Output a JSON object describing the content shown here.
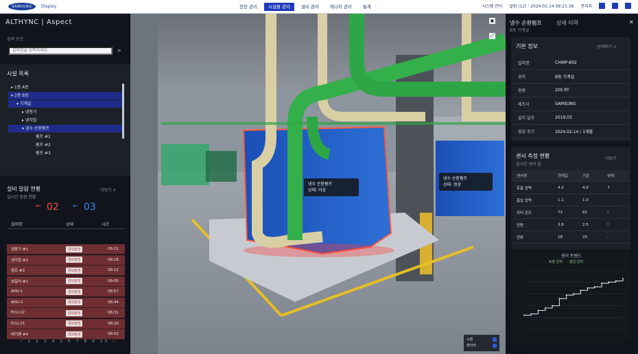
{
  "header": {
    "logo_text": "SAMSUNG",
    "logo_sub": "Display",
    "nav": [
      {
        "label": "현장 관리"
      },
      {
        "label": "시설물 관리"
      },
      {
        "label": "설비 관리"
      },
      {
        "label": "에너지 관리"
      },
      {
        "label": "통계"
      }
    ],
    "right_links": [
      {
        "label": "시스템 관리"
      },
      {
        "label": "알림 (12) · 2024.02.14 09:21:36"
      },
      {
        "label": "관리자"
      }
    ]
  },
  "left_panel": {
    "brand": "ALTHYNC | Aspect",
    "search": {
      "title": "검색 조건",
      "placeholder": "설비명을 입력하세요"
    },
    "tree": {
      "title": "시설 목록",
      "items": [
        {
          "label": "▸ 1층 A동",
          "level": 0,
          "selected": false
        },
        {
          "label": "▾ 2층 B동",
          "level": 0,
          "selected": true
        },
        {
          "label": "▾ 기계실",
          "level": 1,
          "selected": true
        },
        {
          "label": "▸ 냉동기",
          "level": 2,
          "selected": false
        },
        {
          "label": "▸ 냉각탑",
          "level": 2,
          "selected": false
        },
        {
          "label": "▾ 냉수 순환펌프",
          "level": 2,
          "selected": true
        },
        {
          "label": "펌프 #1",
          "level": 3,
          "selected": false
        },
        {
          "label": "펌프 #2",
          "level": 3,
          "selected": false
        },
        {
          "label": "펌프 #3",
          "level": 3,
          "selected": false
        }
      ]
    },
    "alarm": {
      "title": "설비 알람 현황",
      "subtitle": "실시간 알람 현황",
      "more": "더보기 >",
      "red_count": "02",
      "blue_count": "03",
      "columns": [
        "설비명",
        "상태",
        "시간"
      ],
      "rows": [
        {
          "name": "냉동기 #1",
          "status": "경보발생",
          "time": "09:21"
        },
        {
          "name": "냉각탑 #2",
          "status": "경보발생",
          "time": "09:18"
        },
        {
          "name": "펌프 #3",
          "status": "경보발생",
          "time": "09:12"
        },
        {
          "name": "보일러 #1",
          "status": "경보발생",
          "time": "09:05"
        },
        {
          "name": "AHU-1",
          "status": "경보발생",
          "time": "08:57"
        },
        {
          "name": "AHU-2",
          "status": "경보발생",
          "time": "08:44"
        },
        {
          "name": "FCU-12",
          "status": "경보발생",
          "time": "08:31"
        },
        {
          "name": "FCU-15",
          "status": "경보발생",
          "time": "08:20"
        },
        {
          "name": "배기팬 #4",
          "status": "경보발생",
          "time": "08:02"
        }
      ],
      "pager": "‹ 1 2 3 4 5 6 7 8 9 10 ›"
    }
  },
  "scene": {
    "tag_main": {
      "line1": "냉수 순환펌프",
      "line2": "상태: 이상"
    },
    "tag_right": {
      "line1": "냉수 순환펌프",
      "line2": "상태: 정상"
    },
    "bottom_controls": [
      {
        "label": "시점"
      },
      {
        "label": "레이어"
      }
    ],
    "toolbar": [
      {
        "icon": "layers-icon"
      },
      {
        "icon": "expand-icon"
      }
    ]
  },
  "right_panel": {
    "title": "냉수 순환펌프",
    "subtitle": "B동 기계실",
    "tab2": "상세 이력",
    "info": {
      "title": "기본 정보",
      "more": "상세보기 >",
      "rows": [
        {
          "key": "설비명",
          "value": "CHWP-B02"
        },
        {
          "key": "위치",
          "value": "B동 기계실"
        },
        {
          "key": "용량",
          "value": "200 RT"
        },
        {
          "key": "제조사",
          "value": "SAMSUNG"
        },
        {
          "key": "설치 일자",
          "value": "2019.03"
        },
        {
          "key": "점검 주기",
          "value": "2024.02.14 / 1개월"
        }
      ]
    },
    "sensors": {
      "title": "센서 측정 현황",
      "subtitle": "실시간 센서 값",
      "more": "더보기",
      "columns": [
        "센서명",
        "현재값",
        "기준",
        "상태"
      ],
      "rows": [
        {
          "name": "토출 압력",
          "value": "4.2",
          "std": "4.0",
          "state": "↑"
        },
        {
          "name": "흡입 압력",
          "value": "1.1",
          "std": "1.0",
          "state": "-"
        },
        {
          "name": "모터 온도",
          "value": "72",
          "std": "65",
          "state": "!"
        },
        {
          "name": "진동",
          "value": "3.8",
          "std": "2.5",
          "state": "!"
        },
        {
          "name": "전류",
          "value": "18",
          "std": "20",
          "state": "-"
        }
      ]
    },
    "chart": {
      "title": "센서 트렌드",
      "legend": [
        "토출 압력",
        "흡입 압력"
      ]
    }
  },
  "chart_data": {
    "type": "line",
    "title": "센서 트렌드",
    "x": [
      0,
      1,
      2,
      3,
      4,
      5,
      6,
      7,
      8,
      9,
      10,
      11,
      12,
      13,
      14
    ],
    "series": [
      {
        "name": "토출 압력",
        "values": [
          1.2,
          1.3,
          1.6,
          1.8,
          2.0,
          2.6,
          2.9,
          3.0,
          3.3,
          3.5,
          3.6,
          3.9,
          4.0,
          4.1,
          4.3
        ]
      }
    ],
    "ylim": [
      0,
      5
    ],
    "grid": true
  }
}
